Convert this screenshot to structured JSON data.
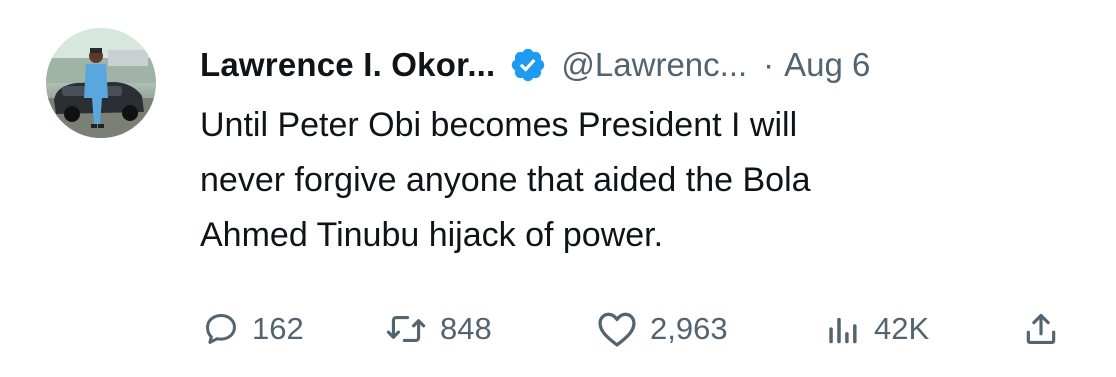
{
  "tweet": {
    "author": {
      "display_name": "Lawrence I. Okor...",
      "handle": "@Lawrenc...",
      "verified": true,
      "verified_color": "#1d9bf0"
    },
    "separator": "·",
    "date": "Aug 6",
    "text_lines": [
      "Until Peter Obi becomes President I will",
      "never forgive anyone that aided the Bola",
      "Ahmed Tinubu hijack of power."
    ],
    "metrics": {
      "replies": "162",
      "retweets": "848",
      "likes": "2,963",
      "views": "42K"
    },
    "icons": {
      "reply": "reply-icon",
      "retweet": "retweet-icon",
      "like": "heart-icon",
      "views": "views-icon",
      "share": "share-icon"
    },
    "colors": {
      "text_primary": "#0f1419",
      "text_secondary": "#536471",
      "accent": "#1d9bf0"
    }
  }
}
